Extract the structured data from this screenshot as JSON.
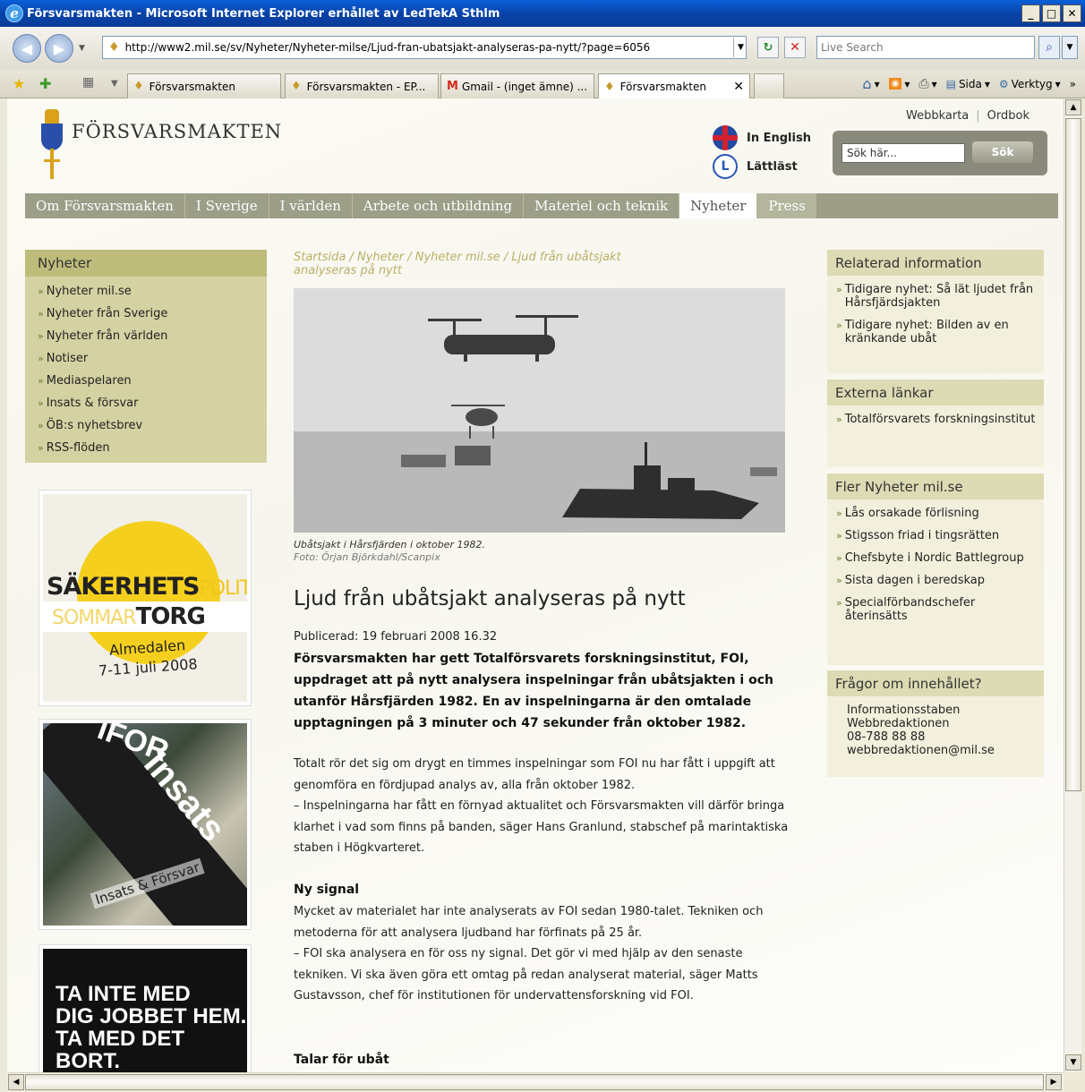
{
  "window": {
    "title": "Försvarsmakten - Microsoft Internet Explorer erhållet av LedTekA Sthlm",
    "buttons": [
      "_",
      "□",
      "✕"
    ]
  },
  "address": {
    "url": "http://www2.mil.se/sv/Nyheter/Nyheter-milse/Ljud-fran-ubatsjakt-analyseras-pa-nytt/?page=6056",
    "search_placeholder": "Live Search"
  },
  "tabs": [
    {
      "label": "Försvarsmakten"
    },
    {
      "label": "Försvarsmakten - EP..."
    },
    {
      "label": "Gmail - (inget ämne) ..."
    },
    {
      "label": "Försvarsmakten"
    }
  ],
  "toolbar": {
    "page_label": "Sida",
    "tools_label": "Verktyg"
  },
  "site": {
    "logo_text": "FÖRSVARSMAKTEN",
    "top_links": [
      "Webbkarta",
      "Ordbok"
    ],
    "lang_english": "In English",
    "lang_easy": "Lättläst",
    "search_value": "Sök här...",
    "search_button": "Sök",
    "nav": [
      "Om Försvarsmakten",
      "I Sverige",
      "I världen",
      "Arbete och utbildning",
      "Materiel och teknik",
      "Nyheter",
      "Press"
    ]
  },
  "leftnav": {
    "title": "Nyheter",
    "items": [
      "Nyheter mil.se",
      "Nyheter från Sverige",
      "Nyheter från världen",
      "Notiser",
      "Mediaspelaren",
      "Insats & försvar",
      "ÖB:s nyhetsbrev",
      "RSS-flöden"
    ]
  },
  "banners": {
    "b1_line1_bold": "SÄKERHETS",
    "b1_line1_light": "POLITISKT",
    "b1_line2_light": "SOMMAR",
    "b1_line2_bold": "TORG",
    "b1_line3": "Almedalen",
    "b1_line4": "7-11 juli 2008",
    "b2_insats": "Insats",
    "b2_ifor": "IFOR",
    "b2_caption": "Insats & Försvar",
    "b3_line1": "TA INTE MED",
    "b3_line2": "DIG JOBBET HEM.",
    "b3_line3": "TA MED DET BORT."
  },
  "article": {
    "breadcrumb": "Startsida / Nyheter / Nyheter mil.se / Ljud från ubåtsjakt analyseras på nytt",
    "photo_caption": "Ubåtsjakt i Hårsfjärden i oktober 1982.",
    "photo_credit": "Foto: Örjan Björkdahl/Scanpix",
    "headline": "Ljud från ubåtsjakt analyseras på nytt",
    "published": "Publicerad: 19 februari 2008 16.32",
    "lead": "Försvarsmakten har gett Totalförsvarets forskningsinstitut, FOI, uppdraget att på nytt analysera inspelningar från ubåtsjakten i och utanför Hårsfjärden 1982. En av inspelningarna är den omtalade upptagningen på 3 minuter och 47 sekunder från oktober 1982.",
    "p1": "Totalt rör det sig om drygt en timmes inspelningar som FOI nu har fått i uppgift att genomföra en fördjupad analys av, alla från oktober 1982.",
    "p2": "– Inspelningarna har fått en förnyad aktualitet och Försvarsmakten vill därför bringa klarhet i vad som finns på banden, säger Hans Granlund, stabschef på marintaktiska staben i Högkvarteret.",
    "subhead1": "Ny signal",
    "p3": "Mycket av materialet har inte analyserats av FOI sedan 1980-talet. Tekniken och metoderna för att analysera ljudband har förfinats på 25 år.",
    "p4": "– FOI ska analysera en för oss ny signal. Det gör vi med hjälp av den senaste tekniken. Vi ska även göra ett omtag på redan analyserat material, säger Matts Gustavsson, chef för institutionen för undervattensforskning vid FOI.",
    "subhead2": "Talar för ubåt"
  },
  "right": {
    "related_title": "Relaterad information",
    "related": [
      "Tidigare nyhet: Så lät ljudet från Hårsfjärdsjakten",
      "Tidigare nyhet: Bilden av en kränkande ubåt"
    ],
    "external_title": "Externa länkar",
    "external": [
      "Totalförsvarets forskningsinstitut"
    ],
    "more_title": "Fler Nyheter mil.se",
    "more": [
      "Lås orsakade förlisning",
      "Stigsson friad i tingsrätten",
      "Chefsbyte i Nordic Battlegroup",
      "Sista dagen i beredskap",
      "Specialförbandschefer återinsätts"
    ],
    "questions_title": "Frågor om innehållet?",
    "contact": [
      "Informationsstaben",
      "Webbredaktionen",
      "08-788 88 88",
      "webbredaktionen@mil.se"
    ]
  }
}
